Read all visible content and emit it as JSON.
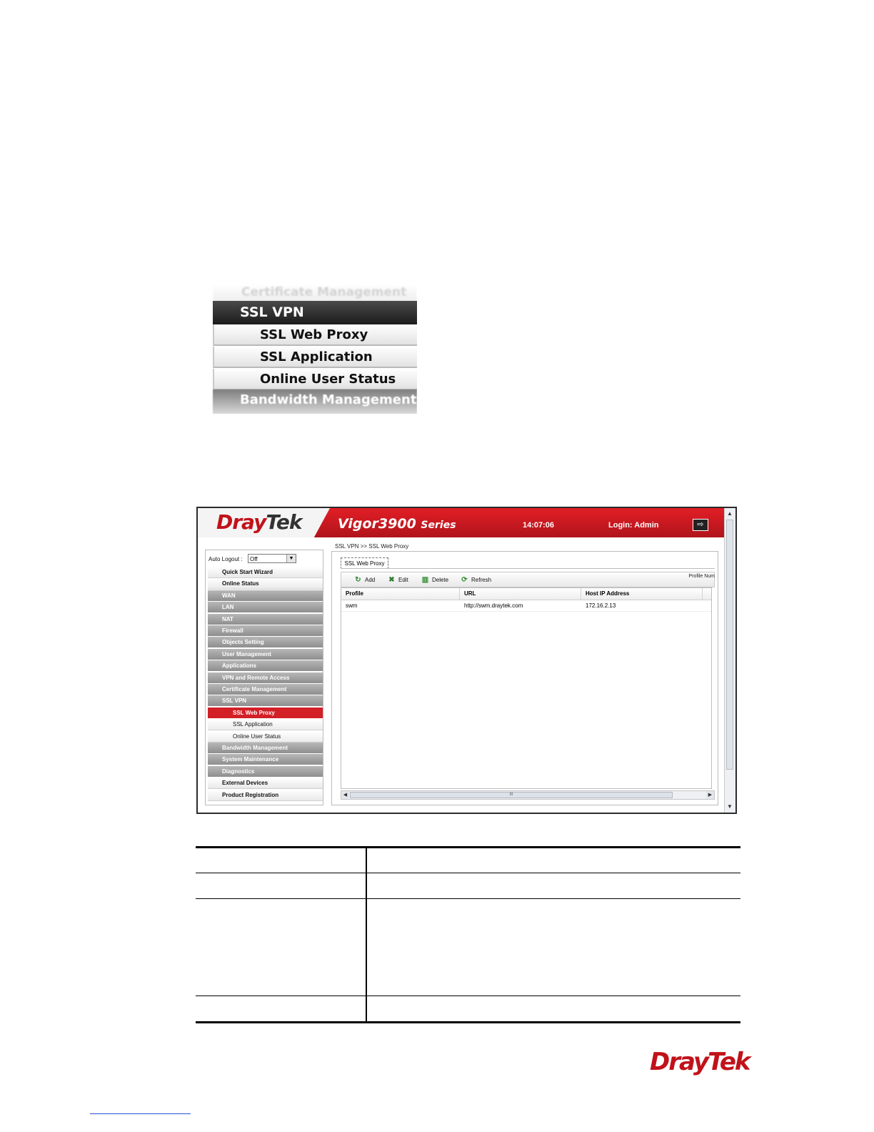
{
  "zoom_menu": {
    "faded_top": "Certificate Management",
    "header": "SSL VPN",
    "items": [
      "SSL Web Proxy",
      "SSL Application",
      "Online User Status"
    ],
    "faded_bottom": "Bandwidth Management"
  },
  "app": {
    "logo_dray": "Dray",
    "logo_tek": "Tek",
    "model": "Vigor3900",
    "series": "Series",
    "clock": "14:07:06",
    "login": "Login: Admin",
    "logout_icon": "logout-icon"
  },
  "sidebar": {
    "auto_logout_label": "Auto Logout :",
    "auto_logout_value": "Off",
    "items": [
      {
        "label": "Quick Start Wizard",
        "style": "white"
      },
      {
        "label": "Online Status",
        "style": "white"
      },
      {
        "label": "WAN",
        "style": "gray"
      },
      {
        "label": "LAN",
        "style": "gray"
      },
      {
        "label": "NAT",
        "style": "gray"
      },
      {
        "label": "Firewall",
        "style": "gray"
      },
      {
        "label": "Objects Setting",
        "style": "gray"
      },
      {
        "label": "User Management",
        "style": "gray"
      },
      {
        "label": "Applications",
        "style": "gray"
      },
      {
        "label": "VPN and Remote Access",
        "style": "gray"
      },
      {
        "label": "Certificate Management",
        "style": "gray"
      },
      {
        "label": "SSL VPN",
        "style": "gray"
      },
      {
        "label": "SSL Web Proxy",
        "style": "active"
      },
      {
        "label": "SSL Application",
        "style": "sub"
      },
      {
        "label": "Online User Status",
        "style": "sub"
      },
      {
        "label": "Bandwidth Management",
        "style": "gray"
      },
      {
        "label": "System Maintenance",
        "style": "gray"
      },
      {
        "label": "Diagnostics",
        "style": "gray"
      },
      {
        "label": "External Devices",
        "style": "white"
      },
      {
        "label": "Product Registration",
        "style": "white"
      }
    ]
  },
  "main": {
    "breadcrumb": "SSL VPN >> SSL Web Proxy",
    "tab": "SSL Web Proxy",
    "toolbar": {
      "add": "Add",
      "edit": "Edit",
      "delete": "Delete",
      "refresh": "Refresh",
      "profile_num": "Profile Num"
    },
    "table": {
      "columns": [
        "Profile",
        "URL",
        "Host IP Address"
      ],
      "rows": [
        [
          "swm",
          "http://swm.draytek.com",
          "172.16.2.13"
        ]
      ]
    },
    "hscroll_grip": "III"
  },
  "footer": {
    "logo_dray": "Dray",
    "logo_tek": "Tek"
  }
}
